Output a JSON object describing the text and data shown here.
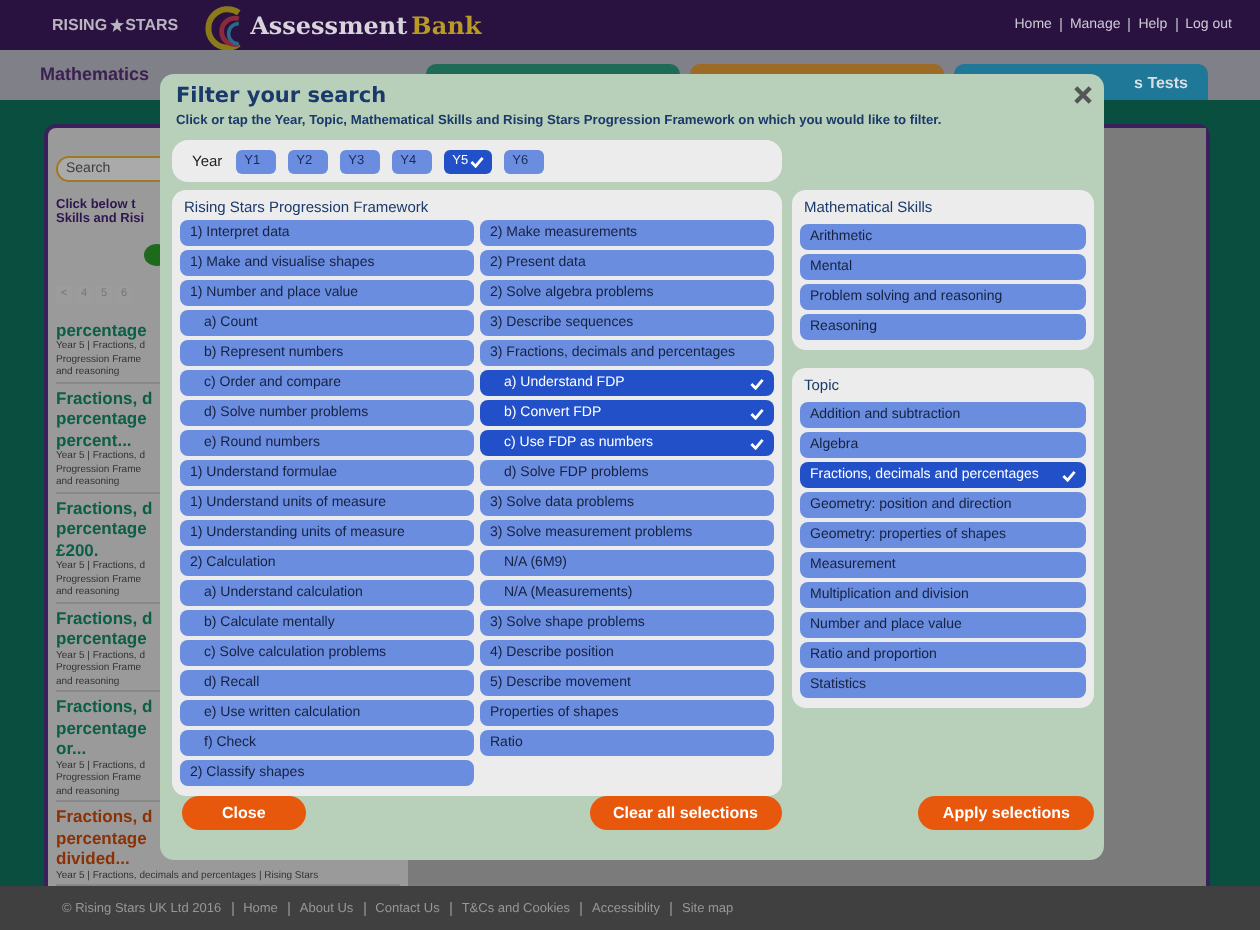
{
  "header": {
    "brand_left": "RISING",
    "brand_right": "STARS",
    "product": "Assessment",
    "product_accent": "Bank",
    "nav": [
      "Home",
      "Manage",
      "Help",
      "Log out"
    ]
  },
  "subject": "Mathematics",
  "test_tabs": [
    {
      "color": "#1e6b58"
    },
    {
      "color": "#9c6b25"
    },
    {
      "color": "#1f7898",
      "label": "s Tests"
    }
  ],
  "search": {
    "placeholder": "Search"
  },
  "intro_lines": [
    "Click below t",
    "Skills and Risi"
  ],
  "pagination": [
    "<",
    "4",
    "5",
    "6"
  ],
  "results": [
    {
      "color": "#0c5e46",
      "title_lines": [
        "percentage"
      ],
      "meta_lines": [
        "Year 5 | Fractions, d",
        "Progression Frame",
        "and reasoning"
      ]
    },
    {
      "color": "#0c5e46",
      "title_lines": [
        "Fractions, d",
        "percentage",
        "percent..."
      ],
      "meta_lines": [
        "Year 5 | Fractions, d",
        "Progression Frame",
        "and reasoning"
      ]
    },
    {
      "color": "#0c5e46",
      "title_lines": [
        "Fractions, d",
        "percentage",
        "£200."
      ],
      "meta_lines": [
        "Year 5 | Fractions, d",
        "Progression Frame",
        "and reasoning"
      ]
    },
    {
      "color": "#0c5e46",
      "title_lines": [
        "Fractions, d",
        "percentage"
      ],
      "meta_lines": [
        "Year 5 | Fractions, d",
        "Progression Frame",
        "and reasoning"
      ]
    },
    {
      "color": "#0c5e46",
      "title_lines": [
        "Fractions, d",
        "percentage",
        "or..."
      ],
      "meta_lines": [
        "Year 5 | Fractions, d",
        "Progression Frame",
        "and reasoning"
      ]
    },
    {
      "color": "#8a3206",
      "title_lines": [
        "Fractions, d",
        "percentage",
        "divided..."
      ],
      "meta_lines": [
        "Year 5 | Fractions, decimals and percentages | Rising Stars"
      ]
    }
  ],
  "footer": {
    "copyright": "© Rising Stars UK Ltd 2016",
    "links": [
      "Home",
      "About Us",
      "Contact Us",
      "T&Cs and Cookies",
      "Accessiblity",
      "Site map"
    ]
  },
  "modal": {
    "title": "Filter your search",
    "subtitle": "Click or tap the Year, Topic, Mathematical Skills and Rising Stars Progression Framework on which you would like to filter.",
    "year_label": "Year",
    "years": [
      {
        "label": "Y1",
        "selected": false
      },
      {
        "label": "Y2",
        "selected": false
      },
      {
        "label": "Y3",
        "selected": false
      },
      {
        "label": "Y4",
        "selected": false
      },
      {
        "label": "Y5",
        "selected": true
      },
      {
        "label": "Y6",
        "selected": false
      }
    ],
    "framework": {
      "title": "Rising Stars Progression Framework",
      "columns": [
        [
          {
            "label": "1) Interpret data",
            "selected": false
          },
          {
            "label": "1) Make and visualise shapes",
            "selected": false
          },
          {
            "label": "1) Number and place value",
            "selected": false,
            "children": [
              {
                "label": "a) Count",
                "selected": false
              },
              {
                "label": "b) Represent numbers",
                "selected": false
              },
              {
                "label": "c) Order and compare",
                "selected": false
              },
              {
                "label": "d) Solve number problems",
                "selected": false
              },
              {
                "label": "e) Round numbers",
                "selected": false
              }
            ]
          },
          {
            "label": "1) Understand formulae",
            "selected": false
          },
          {
            "label": "1) Understand units of measure",
            "selected": false
          },
          {
            "label": "1) Understanding units of measure",
            "selected": false
          },
          {
            "label": "2) Calculation",
            "selected": false,
            "children": [
              {
                "label": "a) Understand calculation",
                "selected": false
              },
              {
                "label": "b) Calculate mentally",
                "selected": false
              },
              {
                "label": "c) Solve calculation problems",
                "selected": false
              },
              {
                "label": "d) Recall",
                "selected": false
              },
              {
                "label": "e) Use written calculation",
                "selected": false
              },
              {
                "label": "f) Check",
                "selected": false
              }
            ]
          },
          {
            "label": "2) Classify shapes",
            "selected": false
          }
        ],
        [
          {
            "label": "2) Make measurements",
            "selected": false
          },
          {
            "label": "2) Present data",
            "selected": false
          },
          {
            "label": "2) Solve algebra problems",
            "selected": false
          },
          {
            "label": "3) Describe sequences",
            "selected": false
          },
          {
            "label": "3) Fractions, decimals and percentages",
            "selected": false,
            "children": [
              {
                "label": "a) Understand FDP",
                "selected": true
              },
              {
                "label": "b) Convert FDP",
                "selected": true
              },
              {
                "label": "c) Use FDP as numbers",
                "selected": true
              },
              {
                "label": "d) Solve FDP problems",
                "selected": false
              }
            ]
          },
          {
            "label": "3) Solve data problems",
            "selected": false
          },
          {
            "label": "3) Solve measurement problems",
            "selected": false,
            "children": [
              {
                "label": "N/A (6M9)",
                "selected": false
              },
              {
                "label": "N/A (Measurements)",
                "selected": false
              }
            ]
          },
          {
            "label": "3) Solve shape problems",
            "selected": false
          },
          {
            "label": "4) Describe position",
            "selected": false
          },
          {
            "label": "5) Describe movement",
            "selected": false
          },
          {
            "label": "Properties of shapes",
            "selected": false
          },
          {
            "label": "Ratio",
            "selected": false
          }
        ]
      ]
    },
    "skills": {
      "title": "Mathematical Skills",
      "items": [
        {
          "label": "Arithmetic",
          "selected": false
        },
        {
          "label": "Mental",
          "selected": false
        },
        {
          "label": "Problem solving and reasoning",
          "selected": false
        },
        {
          "label": "Reasoning",
          "selected": false
        }
      ]
    },
    "topic": {
      "title": "Topic",
      "items": [
        {
          "label": "Addition and subtraction",
          "selected": false
        },
        {
          "label": "Algebra",
          "selected": false
        },
        {
          "label": "Fractions, decimals and percentages",
          "selected": true
        },
        {
          "label": "Geometry: position and direction",
          "selected": false
        },
        {
          "label": "Geometry: properties of shapes",
          "selected": false
        },
        {
          "label": "Measurement",
          "selected": false
        },
        {
          "label": "Multiplication and division",
          "selected": false
        },
        {
          "label": "Number and place value",
          "selected": false
        },
        {
          "label": "Ratio and proportion",
          "selected": false
        },
        {
          "label": "Statistics",
          "selected": false
        }
      ]
    },
    "close": "Close",
    "clear": "Clear all selections",
    "apply": "Apply selections"
  }
}
